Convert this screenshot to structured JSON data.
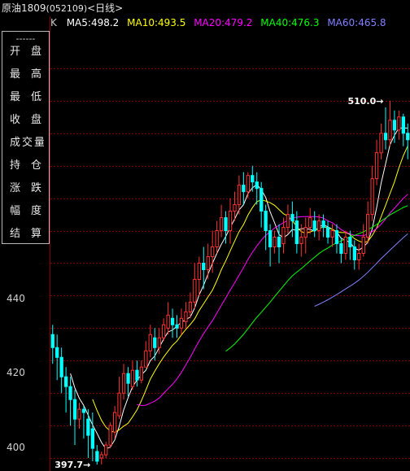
{
  "window": {
    "name": "原油1809",
    "code": "(052109)",
    "period": "<日线>"
  },
  "legend": {
    "k_label": "K",
    "ma": [
      {
        "label": "MA5:498.2",
        "color": "#ffffff"
      },
      {
        "label": "MA10:493.5",
        "color": "#ffff00"
      },
      {
        "label": "MA20:479.2",
        "color": "#ff00ff"
      },
      {
        "label": "MA40:476.3",
        "color": "#00ff00"
      },
      {
        "label": "MA60:465.8",
        "color": "#8080ff"
      }
    ]
  },
  "info_panel": {
    "dash": "------",
    "rows": [
      "开盘",
      "最高",
      "最低",
      "收盘",
      "成交量",
      "持仓",
      "涨跌",
      "幅度",
      "结算"
    ]
  },
  "y_axis": {
    "labels": [
      "440",
      "420",
      "400"
    ]
  },
  "markers": {
    "high": "510.0",
    "low": "397.7"
  },
  "chart_data": {
    "type": "candlestick",
    "y_axis_ticks": [
      400,
      420,
      440
    ],
    "y_range": [
      396,
      532
    ],
    "annotations": [
      {
        "text": "510.0",
        "kind": "high"
      },
      {
        "text": "397.7",
        "kind": "low"
      }
    ],
    "colors": {
      "up": "#ff3232",
      "down": "#00ffff",
      "ma5": "#ffffff",
      "ma10": "#ffff00",
      "ma20": "#ff00ff",
      "ma40": "#00ff00",
      "ma60": "#8080ff"
    },
    "candles": [
      [
        438,
        434,
        441,
        429
      ],
      [
        434,
        431,
        438,
        424
      ],
      [
        431,
        425,
        434,
        420
      ],
      [
        425,
        422,
        428,
        414
      ],
      [
        422,
        418,
        425,
        410
      ],
      [
        418,
        412,
        421,
        404
      ],
      [
        412,
        415,
        417,
        409
      ],
      [
        415,
        414,
        416,
        406
      ],
      [
        412,
        407,
        415,
        400
      ],
      [
        409,
        403,
        414,
        399
      ],
      [
        402,
        399,
        404,
        398
      ],
      [
        400,
        401,
        402,
        398
      ],
      [
        401,
        404,
        405,
        400
      ],
      [
        404,
        410,
        411,
        403
      ],
      [
        408,
        414,
        416,
        406
      ],
      [
        413,
        420,
        425,
        412
      ],
      [
        420,
        426,
        429,
        418
      ],
      [
        426,
        423,
        428,
        419
      ],
      [
        422,
        427,
        430,
        421
      ],
      [
        427,
        424,
        430,
        422
      ],
      [
        424,
        428,
        430,
        423
      ],
      [
        428,
        433,
        436,
        428
      ],
      [
        433,
        438,
        441,
        431
      ],
      [
        437,
        434,
        440,
        430
      ],
      [
        434,
        437,
        440,
        432
      ],
      [
        437,
        441,
        443,
        436
      ],
      [
        440,
        444,
        448,
        438
      ],
      [
        443,
        441,
        446,
        437
      ],
      [
        441,
        440,
        444,
        437
      ],
      [
        440,
        443,
        446,
        438
      ],
      [
        442,
        445,
        448,
        440
      ],
      [
        445,
        448,
        451,
        443
      ],
      [
        448,
        455,
        460,
        446
      ],
      [
        455,
        460,
        462,
        450
      ],
      [
        460,
        458,
        465,
        452
      ],
      [
        458,
        462,
        466,
        455
      ],
      [
        462,
        465,
        470,
        457
      ],
      [
        465,
        470,
        473,
        463
      ],
      [
        470,
        474,
        478,
        468
      ],
      [
        474,
        470,
        476,
        466
      ],
      [
        470,
        476,
        480,
        466
      ],
      [
        476,
        478,
        482,
        473
      ],
      [
        478,
        484,
        487,
        475
      ],
      [
        484,
        482,
        488,
        478
      ],
      [
        482,
        487,
        488,
        480
      ],
      [
        487,
        485,
        490,
        482
      ],
      [
        485,
        483,
        488,
        478
      ],
      [
        483,
        476,
        485,
        471
      ],
      [
        476,
        470,
        478,
        464
      ],
      [
        470,
        465,
        472,
        459
      ],
      [
        465,
        468,
        470,
        463
      ],
      [
        468,
        465,
        472,
        460
      ],
      [
        466,
        471,
        474,
        463
      ],
      [
        471,
        475,
        478,
        469
      ],
      [
        475,
        473,
        479,
        468
      ],
      [
        473,
        466,
        476,
        463
      ],
      [
        466,
        468,
        472,
        462
      ],
      [
        468,
        471,
        474,
        463
      ],
      [
        471,
        474,
        477,
        469
      ],
      [
        473,
        470,
        476,
        468
      ],
      [
        470,
        473,
        475,
        467
      ],
      [
        473,
        471,
        475,
        468
      ],
      [
        471,
        468,
        473,
        466
      ],
      [
        468,
        470,
        472,
        465
      ],
      [
        470,
        466,
        472,
        463
      ],
      [
        466,
        463,
        468,
        460
      ],
      [
        463,
        468,
        470,
        461
      ],
      [
        468,
        465,
        470,
        461
      ],
      [
        465,
        461,
        467,
        458
      ],
      [
        461,
        463,
        466,
        458
      ],
      [
        463,
        468,
        472,
        462
      ],
      [
        468,
        475,
        479,
        466
      ],
      [
        475,
        486,
        490,
        473
      ],
      [
        486,
        494,
        498,
        484
      ],
      [
        494,
        500,
        503,
        492
      ],
      [
        500,
        498,
        508,
        495
      ],
      [
        498,
        504,
        510,
        496
      ],
      [
        504,
        501,
        507,
        497
      ],
      [
        501,
        505,
        507,
        498
      ],
      [
        505,
        500,
        506,
        496
      ],
      [
        500,
        498,
        503,
        492
      ]
    ]
  }
}
